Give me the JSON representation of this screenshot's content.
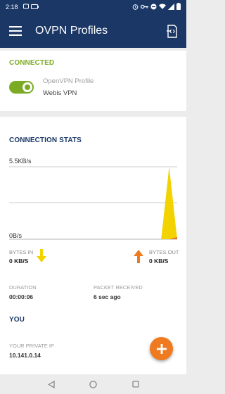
{
  "status_bar": {
    "time": "2:18",
    "icons_left": [
      "notification-icon",
      "battery-saver-icon"
    ],
    "icons_right": [
      "alarm-icon",
      "vpn-key-icon",
      "do-not-disturb-icon",
      "wifi-icon",
      "signal-icon",
      "battery-icon"
    ]
  },
  "app_bar": {
    "title": "OVPN Profiles",
    "menu_icon": "hamburger-menu-icon",
    "import_icon": "import-profile-icon"
  },
  "connected": {
    "section_title": "CONNECTED",
    "toggle_on": true,
    "profile_name": "OpenVPN Profile",
    "profile_sub": "Webis VPN"
  },
  "stats": {
    "section_title": "CONNECTION STATS",
    "chart_data": {
      "type": "area",
      "ylim_labels": [
        "5.5KB/s",
        "0B/s"
      ],
      "series": [
        {
          "color": "#f2d300",
          "values": [
            0,
            0,
            0,
            0,
            0,
            0,
            0,
            0,
            0,
            0,
            0,
            0,
            0,
            0,
            0,
            0,
            0,
            0,
            0,
            0,
            1.0,
            0
          ]
        },
        {
          "color": "#ef7a20",
          "values": [
            0,
            0,
            0,
            0,
            0,
            0,
            0,
            0,
            0,
            0,
            0,
            0,
            0,
            0,
            0,
            0,
            0,
            0,
            0,
            0,
            0,
            0.03
          ]
        }
      ]
    },
    "bytes_in_label": "BYTES IN",
    "bytes_in_value": "0 KB/S",
    "bytes_out_label": "BYTES OUT",
    "bytes_out_value": "0 KB/S",
    "duration_label": "DURATION",
    "duration_value": "00:00:06",
    "packet_label": "PACKET RECEIVED",
    "packet_value": "6 sec ago"
  },
  "you": {
    "section_title": "YOU",
    "ip_label": "YOUR PRIVATE IP",
    "ip_value": "10.141.0.14"
  },
  "colors": {
    "primary": "#1a3766",
    "accent_green": "#7bab24",
    "accent_orange": "#ef7a20",
    "chart_yellow": "#f2d300"
  }
}
